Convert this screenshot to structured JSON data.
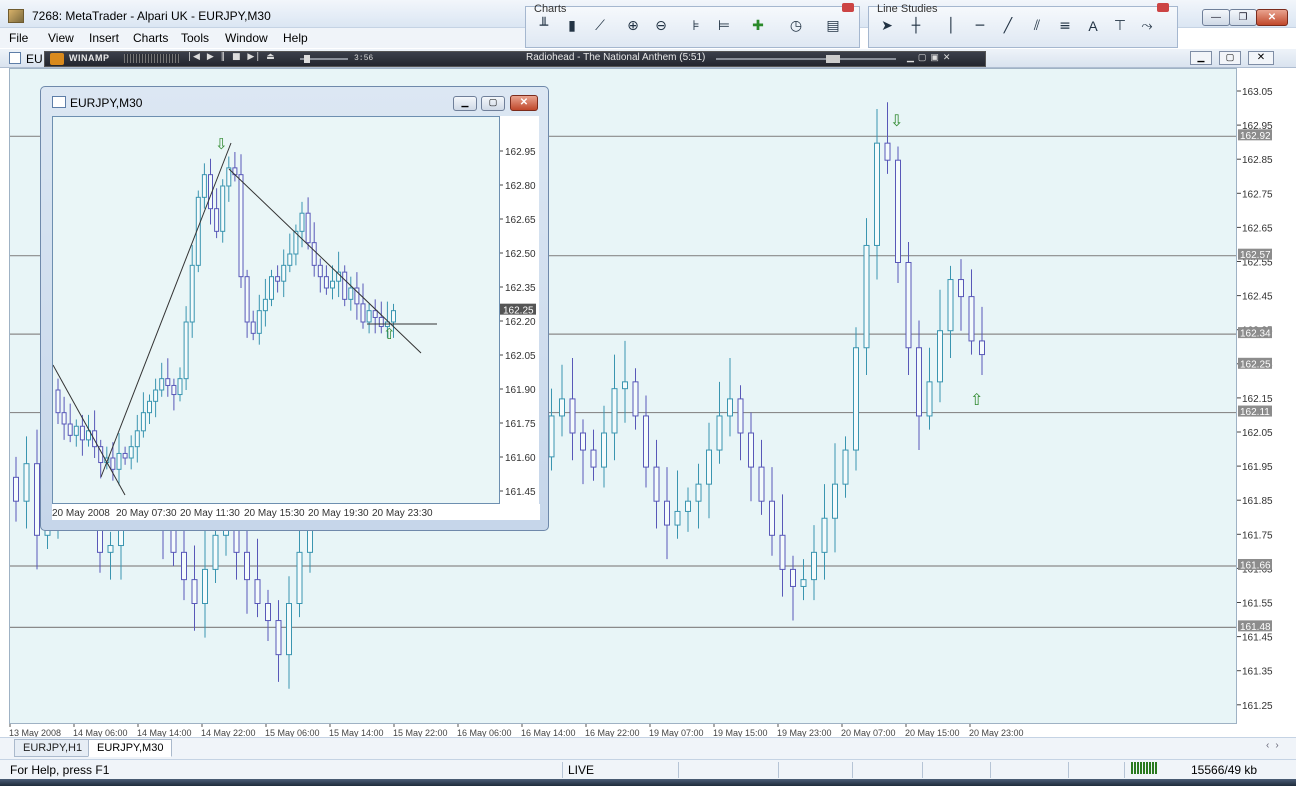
{
  "window": {
    "title": "7268: MetaTrader - Alpari UK - EURJPY,M30",
    "controls": [
      "minimize",
      "maximize",
      "close"
    ]
  },
  "menu": {
    "items": [
      "File",
      "View",
      "Insert",
      "Charts",
      "Tools",
      "Window",
      "Help"
    ]
  },
  "toolbars": {
    "charts": {
      "caption": "Charts",
      "icons": [
        "bar-chart-icon",
        "candlestick-icon",
        "line-chart-icon",
        "zoom-in-icon",
        "zoom-out-icon",
        "chart-shift-icon",
        "autoscroll-icon",
        "add-indicator-icon",
        "periods-icon",
        "templates-icon"
      ]
    },
    "line_studies": {
      "caption": "Line Studies",
      "icons": [
        "cursor-icon",
        "crosshair-icon",
        "vertical-line-icon",
        "horizontal-line-icon",
        "trendline-icon",
        "equidistant-channel-icon",
        "fibonacci-icon",
        "text-icon",
        "text-label-icon",
        "arrows-icon"
      ]
    }
  },
  "mdi": {
    "child_label": "EU",
    "winamp": {
      "label": "WINAMP",
      "controls": "|◀ ▶ ‖ ■ ▶| ⏏",
      "time": "3:56",
      "song": "Radiohead - The National Anthem (5:51)"
    }
  },
  "main_chart": {
    "symbol": "EURJPY,H1",
    "price_ticks": [
      "163.05",
      "162.95",
      "162.85",
      "162.75",
      "162.65",
      "162.55",
      "162.45",
      "162.35",
      "162.25",
      "162.15",
      "162.05",
      "161.95",
      "161.85",
      "161.75",
      "161.65",
      "161.55",
      "161.45",
      "161.35",
      "161.25"
    ],
    "level_labels": [
      "162.92",
      "162.57",
      "162.34",
      "162.25",
      "162.11",
      "161.66",
      "161.48"
    ],
    "date_ticks": [
      "13 May 2008",
      "14 May 06:00",
      "14 May 14:00",
      "14 May 22:00",
      "15 May 06:00",
      "15 May 14:00",
      "15 May 22:00",
      "16 May 06:00",
      "16 May 14:00",
      "16 May 22:00",
      "19 May 07:00",
      "19 May 15:00",
      "19 May 23:00",
      "20 May 07:00",
      "20 May 15:00",
      "20 May 23:00"
    ]
  },
  "float_window": {
    "title": "EURJPY,M30",
    "price_ticks": [
      "162.95",
      "162.80",
      "162.65",
      "162.50",
      "162.35",
      "162.20",
      "162.05",
      "161.90",
      "161.75",
      "161.60",
      "161.45"
    ],
    "current_price": "162.25",
    "date_ticks": [
      "20 May 2008",
      "20 May 07:30",
      "20 May 11:30",
      "20 May 15:30",
      "20 May 19:30",
      "20 May 23:30"
    ]
  },
  "tabs": [
    "EURJPY,H1",
    "EURJPY,M30"
  ],
  "active_tab": 1,
  "status": {
    "help": "For Help, press F1",
    "connection": "LIVE",
    "traffic": "15566/49 kb"
  },
  "colors": {
    "chart_bg": "#e8f5f7",
    "bull_candle": "#3a95b0",
    "bear_candle": "#5858b8",
    "level_line": "#8a8a8a",
    "arrow": "#2f8a2f",
    "price_label_bg": "#8c8c8c"
  }
}
